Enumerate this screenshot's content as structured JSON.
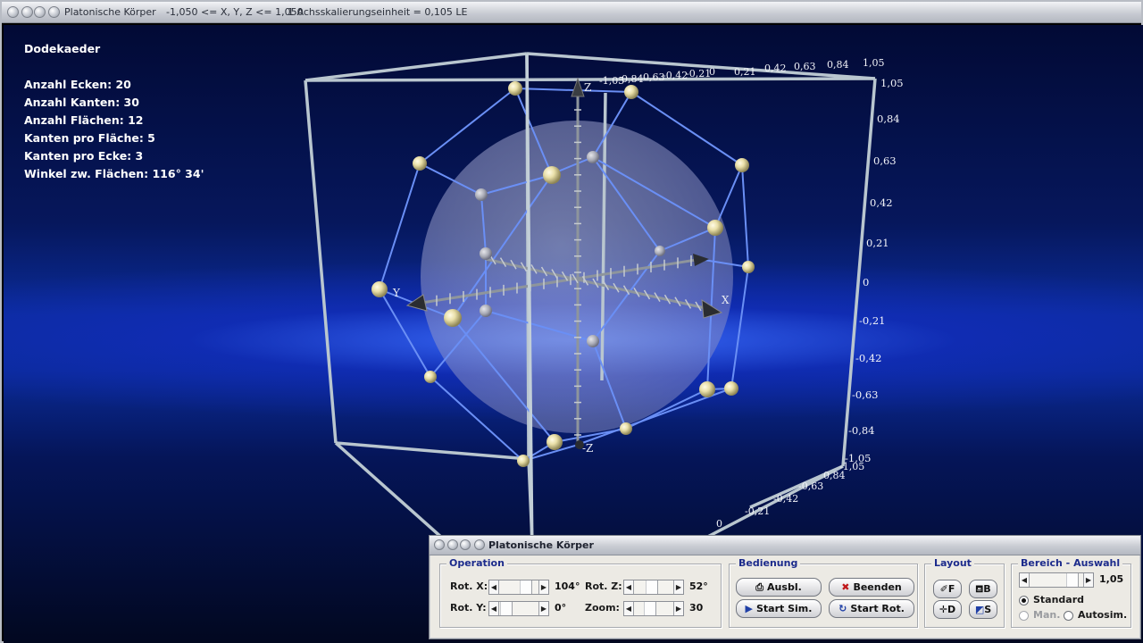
{
  "window": {
    "title": "Platonische Körper",
    "range_text": "-1,050 <= X, Y, Z <= 1,050",
    "scale_text": "1 Achsskalierungseinheit = 0,105 LE"
  },
  "info": {
    "solid_name": "Dodekaeder",
    "vertices": "Anzahl Ecken: 20",
    "edges": "Anzahl Kanten: 30",
    "faces": "Anzahl Flächen: 12",
    "edges_per_face": "Kanten pro Fläche: 5",
    "edges_per_vertex": "Kanten pro Ecke: 3",
    "dihedral_angle": "Winkel zw. Flächen: 116° 34'"
  },
  "axes": {
    "x_label": "X",
    "y_label": "Y",
    "z_label": "Z",
    "neg_z_label": "-Z",
    "right_ticks": [
      "1,05",
      "0,84",
      "0,63",
      "0,42",
      "0,21",
      "0",
      "-0,21",
      "-0,42",
      "-0,63",
      "-0,84",
      "-1,05"
    ],
    "top_ticks_left": [
      "-1,05",
      "0,84",
      "0,63",
      "-0,42",
      "-0,21",
      "0"
    ],
    "top_ticks_right": [
      "0,21",
      "0,42",
      "0,63",
      "0,84",
      "1,05"
    ],
    "bottom_ticks": [
      "0,84",
      "-0,63",
      "-0,42",
      "-0,21",
      "0",
      "-1,05"
    ]
  },
  "panel": {
    "title": "Platonische Körper",
    "operation": {
      "label": "Operation",
      "rot_x_label": "Rot. X:",
      "rot_x_value": "104°",
      "rot_y_label": "Rot. Y:",
      "rot_y_value": "0°",
      "rot_z_label": "Rot. Z:",
      "rot_z_value": "52°",
      "zoom_label": "Zoom:",
      "zoom_value": "30"
    },
    "bedienung": {
      "label": "Bedienung",
      "ausbl": "Ausbl.",
      "beenden": "Beenden",
      "start_sim": "Start Sim.",
      "start_rot": "Start Rot."
    },
    "layout": {
      "label": "Layout",
      "f": "F",
      "b": "B",
      "d": "D",
      "s": "S"
    },
    "bereich": {
      "label": "Bereich - Auswahl",
      "value": "1,05",
      "standard": "Standard",
      "man": "Man.",
      "autosim": "Autosim."
    }
  }
}
